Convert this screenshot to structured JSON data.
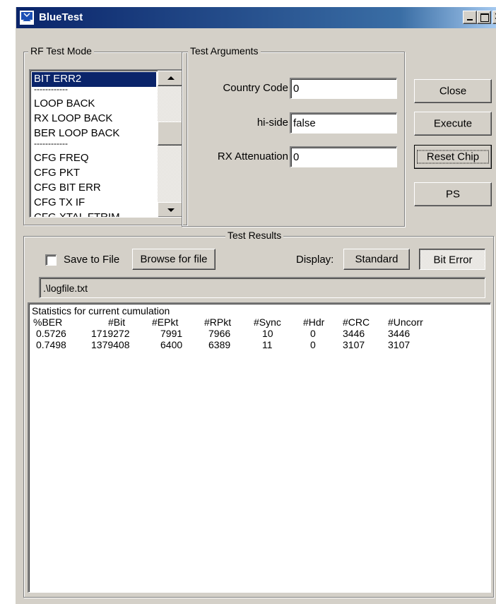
{
  "window": {
    "title": "BlueTest"
  },
  "rf_test_mode": {
    "group_label": "RF Test Mode",
    "items": [
      {
        "label": "BIT ERR2",
        "selected": true
      },
      {
        "label": "------------",
        "separator": true
      },
      {
        "label": "LOOP BACK"
      },
      {
        "label": "RX LOOP BACK"
      },
      {
        "label": "BER LOOP BACK"
      },
      {
        "label": "------------",
        "separator": true
      },
      {
        "label": "CFG FREQ"
      },
      {
        "label": "CFG PKT"
      },
      {
        "label": "CFG BIT ERR"
      },
      {
        "label": "CFG TX IF"
      },
      {
        "label": "CFG XTAL FTRIM"
      }
    ]
  },
  "test_arguments": {
    "group_label": "Test Arguments",
    "country_code": {
      "label": "Country Code",
      "value": "0"
    },
    "hi_side": {
      "label": "hi-side",
      "value": "false"
    },
    "rx_attenuation": {
      "label": "RX Attenuation",
      "value": "0"
    }
  },
  "buttons": {
    "close": "Close",
    "execute": "Execute",
    "reset_chip": "Reset Chip",
    "ps": "PS"
  },
  "test_results": {
    "group_label": "Test Results",
    "save_to_file": {
      "label": "Save to File",
      "checked": false
    },
    "browse_label": "Browse for file",
    "display_label": "Display:",
    "standard_label": "Standard",
    "bit_error_label": "Bit Error",
    "log_path": ".\\logfile.txt",
    "caption": "Statistics for current cumulation",
    "columns": [
      "%BER",
      "#Bit",
      "#EPkt",
      "#RPkt",
      "#Sync",
      "#Hdr",
      "#CRC",
      "#Uncorr"
    ],
    "rows": [
      [
        "0.5726",
        "1719272",
        "7991",
        "7966",
        "10",
        "0",
        "3446",
        "3446"
      ],
      [
        "0.7498",
        "1379408",
        "6400",
        "6389",
        "11",
        "0",
        "3107",
        "3107"
      ]
    ]
  },
  "colors": {
    "title_bar": "#0a246a",
    "face": "#d4d0c8",
    "selection": "#0a246a"
  }
}
